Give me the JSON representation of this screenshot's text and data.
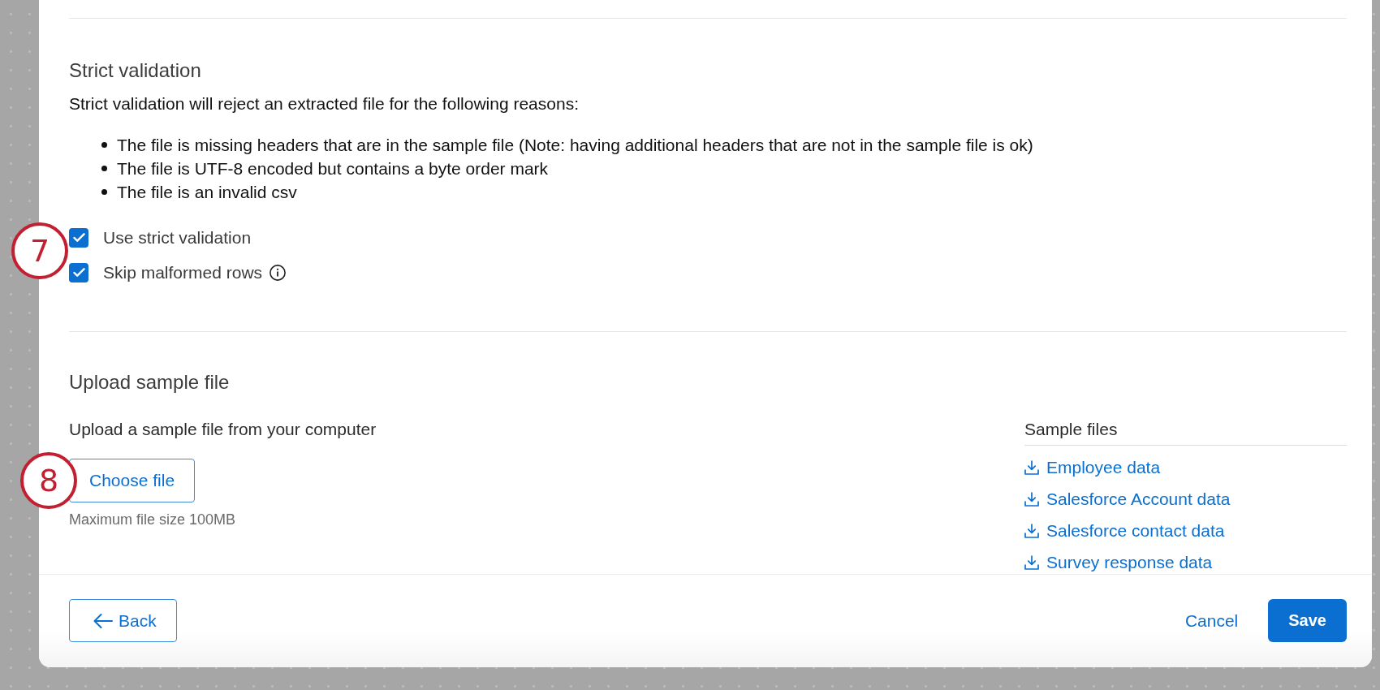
{
  "strict_validation": {
    "title": "Strict validation",
    "description": "Strict validation will reject an extracted file for the following reasons:",
    "reasons": [
      "The file is missing headers that are in the sample file (Note: having additional headers that are not in the sample file is ok)",
      "The file is UTF-8 encoded but contains a byte order mark",
      "The file is an invalid csv"
    ],
    "options": [
      {
        "label": "Use strict validation",
        "checked": true,
        "info": false
      },
      {
        "label": "Skip malformed rows",
        "checked": true,
        "info": true
      }
    ],
    "callout": "7"
  },
  "upload": {
    "title": "Upload sample file",
    "description": "Upload a sample file from your computer",
    "button": "Choose file",
    "hint": "Maximum file size 100MB",
    "callout": "8",
    "sample_files": {
      "title": "Sample files",
      "links": [
        "Employee data",
        "Salesforce Account data",
        "Salesforce contact data",
        "Survey response data"
      ]
    }
  },
  "footer": {
    "back": "Back",
    "cancel": "Cancel",
    "save": "Save"
  }
}
